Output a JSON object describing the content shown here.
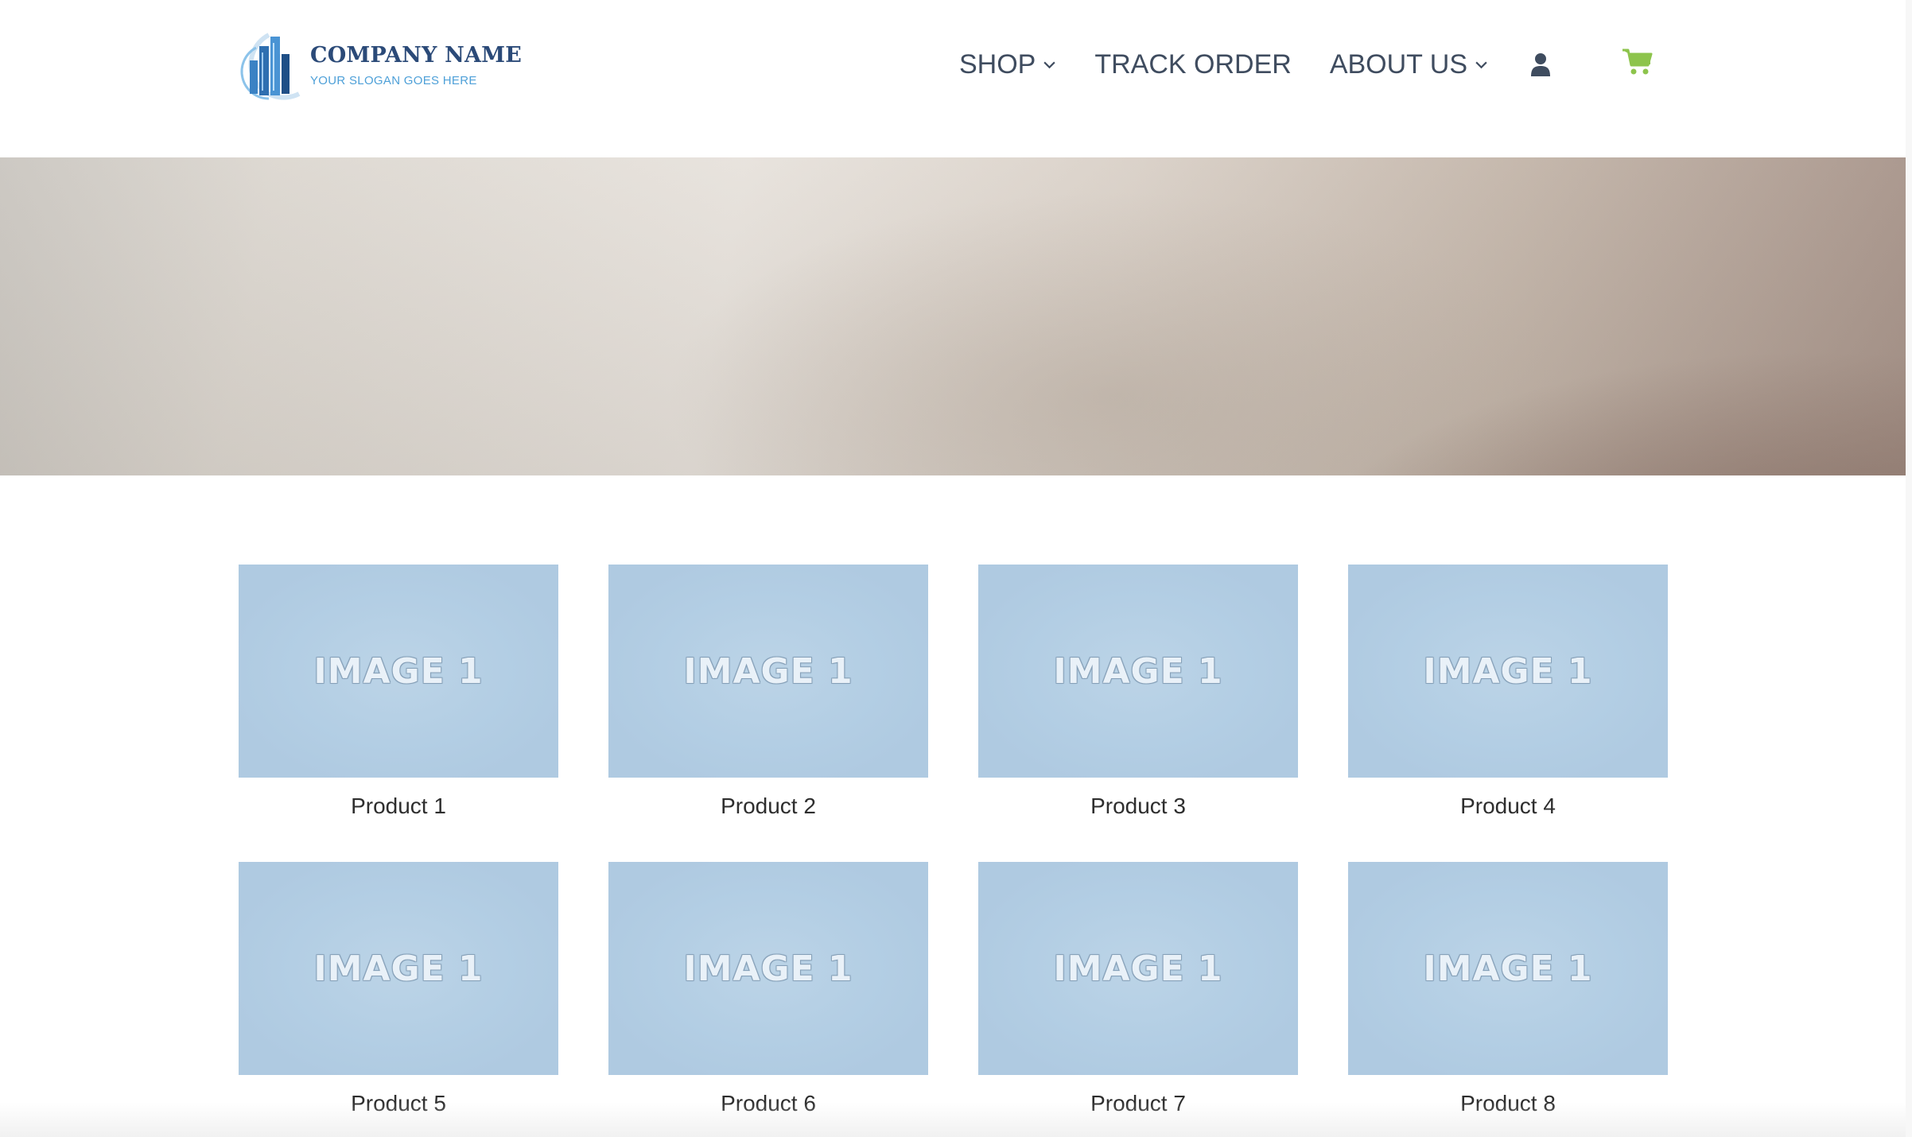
{
  "brand": {
    "name": "COMPANY NAME",
    "slogan": "YOUR SLOGAN GOES HERE",
    "logo_icon": "building-logo-icon",
    "colors": {
      "name": "#2b4a78",
      "slogan": "#4ea0d8",
      "mark": "#3b82c4"
    }
  },
  "nav": {
    "shop_label": "SHOP",
    "track_label": "TRACK ORDER",
    "about_label": "ABOUT US",
    "user_icon": "user-icon",
    "cart_icon": "shopping-cart-icon",
    "colors": {
      "text": "#3f4c5f",
      "cart": "#8dc44c"
    }
  },
  "hero": {
    "style": "warm gray gradient banner"
  },
  "products": [
    {
      "label": "Product 1",
      "image_text": "IMAGE 1"
    },
    {
      "label": "Product 2",
      "image_text": "IMAGE 1"
    },
    {
      "label": "Product 3",
      "image_text": "IMAGE 1"
    },
    {
      "label": "Product 4",
      "image_text": "IMAGE 1"
    },
    {
      "label": "Product 5",
      "image_text": "IMAGE 1"
    },
    {
      "label": "Product 6",
      "image_text": "IMAGE 1"
    },
    {
      "label": "Product 7",
      "image_text": "IMAGE 1"
    },
    {
      "label": "Product 8",
      "image_text": "IMAGE 1"
    }
  ]
}
